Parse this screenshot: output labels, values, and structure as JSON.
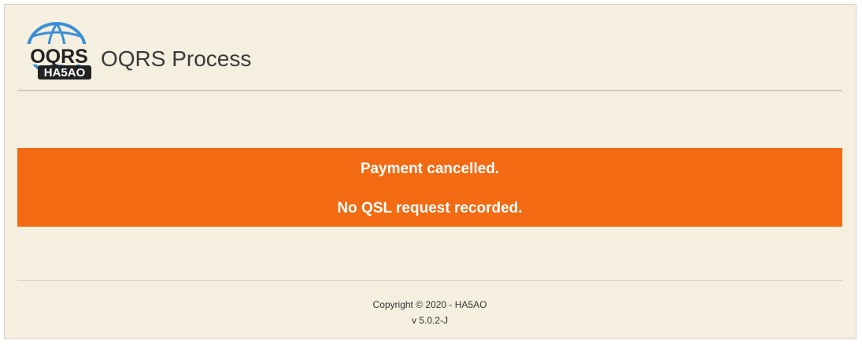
{
  "header": {
    "logo": {
      "icon": "globe-logo-icon",
      "text_main": "OQRS",
      "text_sub": "HA5AO",
      "colors": {
        "globe": "#3a8fd8",
        "text": "#222222",
        "badge": "#222222",
        "badge_text": "#ffffff"
      }
    },
    "title": "OQRS Process"
  },
  "banner": {
    "line1": "Payment cancelled.",
    "line2": "No QSL request recorded.",
    "color": "#f26b13"
  },
  "footer": {
    "copyright": "Copyright © 2020 - HA5AO",
    "version": "v 5.0.2-J"
  }
}
